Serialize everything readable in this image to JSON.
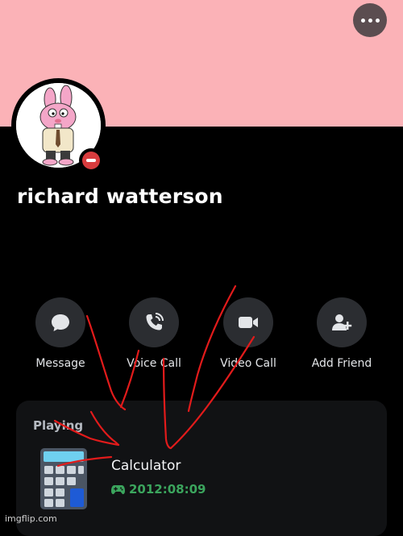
{
  "profile": {
    "display_name": "richard watterson",
    "status": "do-not-disturb",
    "banner_color": "#fbb2b7",
    "status_color": "#d83c3e"
  },
  "actions": [
    {
      "label": "Message",
      "icon": "chat-bubble-icon"
    },
    {
      "label": "Voice Call",
      "icon": "phone-call-icon"
    },
    {
      "label": "Video Call",
      "icon": "video-camera-icon"
    },
    {
      "label": "Add Friend",
      "icon": "add-friend-icon"
    }
  ],
  "activity": {
    "heading": "Playing",
    "game_name": "Calculator",
    "elapsed": "2012:08:09",
    "elapsed_icon": "gamepad-icon",
    "elapsed_color": "#3ba55d"
  },
  "watermark": "imgflip.com"
}
